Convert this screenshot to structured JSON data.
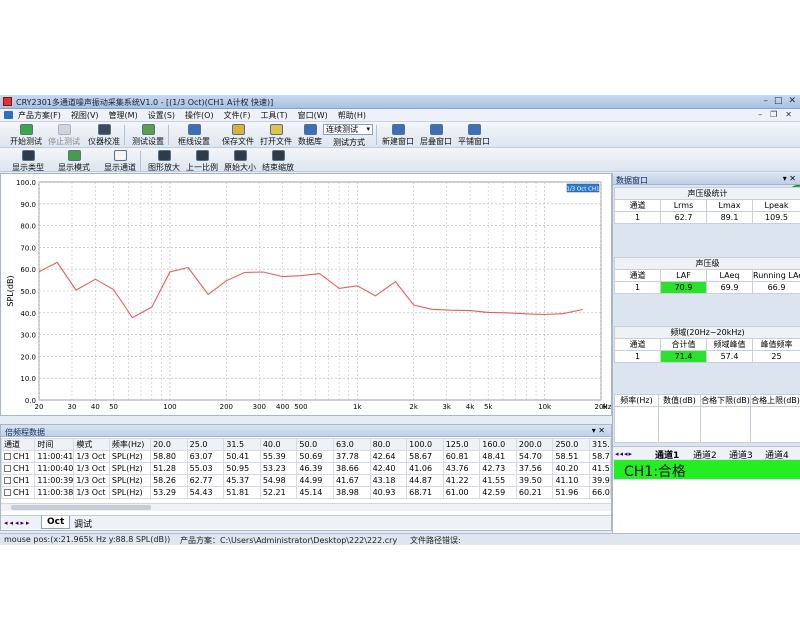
{
  "window": {
    "title": "CRY2301多通道噪声振动采集系统V1.0 - [(1/3 Oct)(CH1 A计权 快速)]"
  },
  "menu": {
    "items": [
      "产品方案(F)",
      "视图(V)",
      "管理(M)",
      "设置(S)",
      "操作(O)",
      "文件(F)",
      "工具(T)",
      "窗口(W)",
      "帮助(H)"
    ]
  },
  "toolbar1": {
    "start": "开始测试",
    "stop": "停止测试",
    "calib": "仪器校准",
    "test_setup": "测试设置",
    "curve_setup": "框线设置",
    "save": "保存文件",
    "open": "打开文件",
    "database": "数据库",
    "mode_value": "连续测试",
    "mode_caption": "测试方式",
    "new_win": "新建窗口",
    "cascade": "层叠窗口",
    "tile": "平铺窗口"
  },
  "toolbar2": {
    "disp_type": "显示类型",
    "disp_mode": "显示模式",
    "disp_channel": "显示通道",
    "zoom": "图形放大",
    "prev_ratio": "上一比例",
    "orig_size": "原始大小",
    "end_zoom": "结束缩放"
  },
  "chart_data": {
    "type": "line",
    "xscale": "log",
    "ylabel": "SPL(dB)",
    "xunit": "Hz",
    "ylim": [
      0,
      100
    ],
    "yticks": [
      "0.0",
      "10.0",
      "20.0",
      "30.0",
      "40.0",
      "50.0",
      "60.0",
      "70.0",
      "80.0",
      "90.0",
      "100.0"
    ],
    "xticks": [
      {
        "v": 20,
        "label": "20"
      },
      {
        "v": 30,
        "label": "30"
      },
      {
        "v": 40,
        "label": "40"
      },
      {
        "v": 50,
        "label": "50"
      },
      {
        "v": 100,
        "label": "100"
      },
      {
        "v": 200,
        "label": "200"
      },
      {
        "v": 300,
        "label": "300"
      },
      {
        "v": 400,
        "label": "400"
      },
      {
        "v": 500,
        "label": "500"
      },
      {
        "v": 1000,
        "label": "1k"
      },
      {
        "v": 2000,
        "label": "2k"
      },
      {
        "v": 3000,
        "label": "3k"
      },
      {
        "v": 4000,
        "label": "4k"
      },
      {
        "v": 5000,
        "label": "5k"
      },
      {
        "v": 10000,
        "label": "10k"
      },
      {
        "v": 20000,
        "label": "20k"
      }
    ],
    "legend": "1/3 Oct CH1",
    "line_color": "#e06060",
    "series": [
      {
        "x": [
          20,
          25,
          31.5,
          40,
          50,
          63,
          80,
          100,
          125,
          160,
          200,
          250,
          315,
          400,
          500,
          630,
          800,
          1000,
          1250,
          1600,
          2000,
          2500,
          3150,
          4000,
          5000,
          6300,
          8000,
          10000,
          12500,
          16000
        ],
        "values": [
          58.8,
          63.1,
          50.4,
          55.4,
          50.7,
          37.8,
          42.6,
          58.7,
          60.8,
          48.4,
          54.7,
          58.5,
          58.7,
          56.6,
          57.0,
          58.0,
          51.2,
          52.4,
          47.8,
          54.3,
          43.6,
          41.6,
          41.2,
          41.0,
          40.2,
          40.0,
          39.5,
          39.2,
          39.6,
          41.5
        ]
      }
    ]
  },
  "grid": {
    "caption": "倍频程数据",
    "headers": [
      "通道",
      "时间",
      "模式",
      "频率(Hz)",
      "20.0",
      "25.0",
      "31.5",
      "40.0",
      "50.0",
      "63.0",
      "80.0",
      "100.0",
      "125.0",
      "160.0",
      "200.0",
      "250.0",
      "315."
    ],
    "rows": [
      [
        "CH1",
        "11:00:41",
        "1/3 Oct",
        "SPL(Hz)",
        "58.80",
        "63.07",
        "50.41",
        "55.39",
        "50.69",
        "37.78",
        "42.64",
        "58.67",
        "60.81",
        "48.41",
        "54.70",
        "58.51",
        "58.7"
      ],
      [
        "CH1",
        "11:00:40",
        "1/3 Oct",
        "SPL(Hz)",
        "51.28",
        "55.03",
        "50.95",
        "53.23",
        "46.39",
        "38.66",
        "42.40",
        "41.06",
        "43.76",
        "42.73",
        "37.56",
        "40.20",
        "41.5"
      ],
      [
        "CH1",
        "11:00:39",
        "1/3 Oct",
        "SPL(Hz)",
        "58.26",
        "62.77",
        "45.37",
        "54.98",
        "44.99",
        "41.67",
        "43.18",
        "44.87",
        "41.22",
        "41.55",
        "39.50",
        "41.10",
        "39.9"
      ],
      [
        "CH1",
        "11:00:38",
        "1/3 Oct",
        "SPL(Hz)",
        "53.29",
        "54.43",
        "51.81",
        "52.21",
        "45.14",
        "38.98",
        "40.93",
        "68.71",
        "61.00",
        "42.59",
        "60.21",
        "51.96",
        "66.0"
      ]
    ],
    "tabs": [
      "Oct",
      "调试"
    ]
  },
  "status": {
    "mouse": "mouse pos:(x:21.965k Hz   y:88.8 SPL(dB))",
    "product": "产品方案：C:\\Users\\Administrator\\Desktop\\222\\222.cry",
    "file_path": "文件路径错误:"
  },
  "right_panel": {
    "caption": "数据窗口",
    "spl_stats": {
      "title": "声压级统计",
      "headers": [
        "通道",
        "Lrms",
        "Lmax",
        "Lpeak"
      ],
      "row": [
        "1",
        "62.7",
        "89.1",
        "109.5"
      ]
    },
    "spl": {
      "title": "声压级",
      "headers": [
        "通道",
        "LAF",
        "LAeq",
        "Running LAeq"
      ],
      "row": [
        "1",
        "70.9",
        "69.9",
        "66.9"
      ]
    },
    "band": {
      "title": "频域(20Hz~20kHz)",
      "headers": [
        "通道",
        "合计值",
        "频域峰值",
        "峰值频率"
      ],
      "row": [
        "1",
        "71.4",
        "57.4",
        "25"
      ]
    },
    "limits": {
      "headers": [
        "频率(Hz)",
        "数值(dB)",
        "合格下限(dB)",
        "合格上限(dB)"
      ]
    },
    "channel_tabs": [
      "通道1",
      "通道2",
      "通道3",
      "通道4"
    ],
    "result": "CH1:合格",
    "highlight_color": "#2be22b"
  }
}
